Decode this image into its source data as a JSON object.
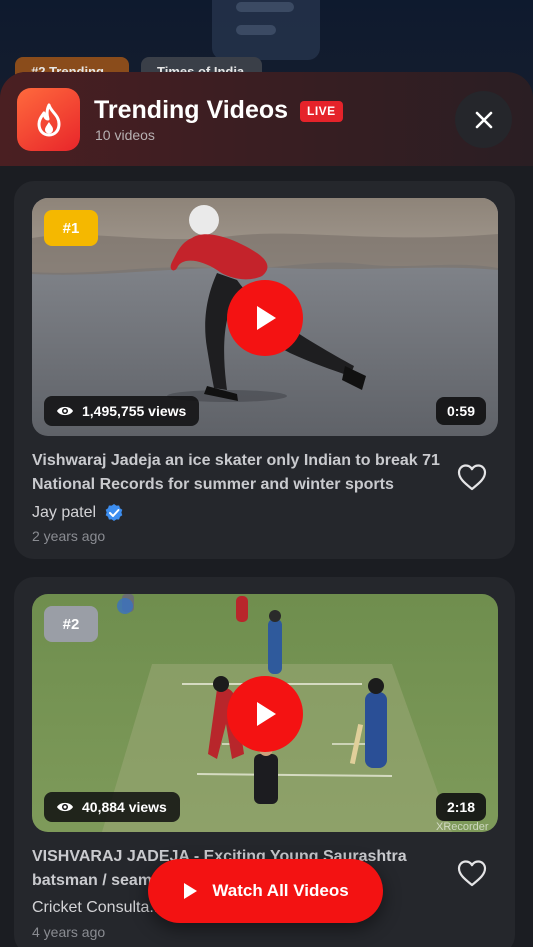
{
  "background": {
    "chips": [
      "#2 Trending",
      "Times of India"
    ]
  },
  "header": {
    "title": "Trending Videos",
    "live_badge": "LIVE",
    "subtitle": "10 videos",
    "icon": "fire-icon",
    "close_icon": "close-icon"
  },
  "videos": [
    {
      "rank": "#1",
      "views": "1,495,755 views",
      "duration": "0:59",
      "title": "Vishwaraj Jadeja an ice skater only Indian to break 71 National Records for summer and winter sports",
      "channel": "Jay patel",
      "verified": true,
      "age": "2 years ago"
    },
    {
      "rank": "#2",
      "views": "40,884 views",
      "duration": "2:18",
      "title": "VISHVARAJ JADEJA - Exciting Young Saurashtra batsman / seam...",
      "channel": "Cricket Consulta...",
      "verified": false,
      "age": "4 years ago",
      "watermark": "XRecorder"
    }
  ],
  "cta": {
    "label": "Watch All Videos",
    "icon": "play-icon"
  },
  "colors": {
    "accent": "#f31212",
    "gold_rank": "#f5b800",
    "silver_rank": "#9a9ea6",
    "verified": "#3d8ef0"
  }
}
